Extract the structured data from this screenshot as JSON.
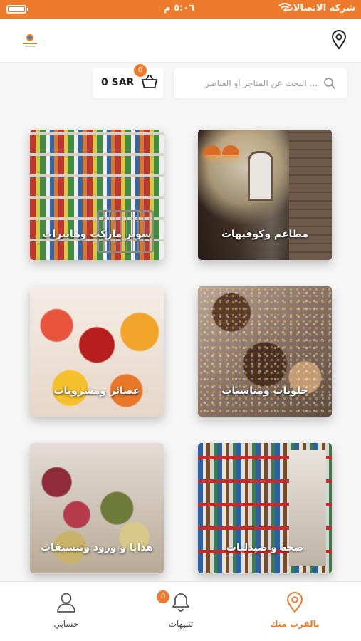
{
  "status_bar": {
    "carrier": "شركة الاتصالات",
    "time": "٥:٠٦ م"
  },
  "header": {
    "logo": "app-logo",
    "location_icon": "location-pin-icon"
  },
  "search": {
    "placeholder": "... البحث عن المتاجر أو العناصر"
  },
  "cart": {
    "amount": "0 SAR",
    "count": "0",
    "icon": "basket-icon"
  },
  "categories": [
    {
      "label": "مطاعم وكوفيهات"
    },
    {
      "label": "سوبر ماركت وهايبرات"
    },
    {
      "label": "حلويات ومناسبات"
    },
    {
      "label": "عصائر ومشروبات"
    },
    {
      "label": "صحة و صيدليات"
    },
    {
      "label": "هدايا و ورود وتنسيقات"
    }
  ],
  "bottom_nav": {
    "items": [
      {
        "label": "بالقرب منك",
        "icon": "location-pin-icon",
        "active": true
      },
      {
        "label": "تنبيهات",
        "icon": "bell-icon",
        "badge": "0"
      },
      {
        "label": "حسابي",
        "icon": "user-icon"
      }
    ]
  },
  "colors": {
    "accent": "#ee7a2b",
    "background": "#f6f6f6"
  }
}
